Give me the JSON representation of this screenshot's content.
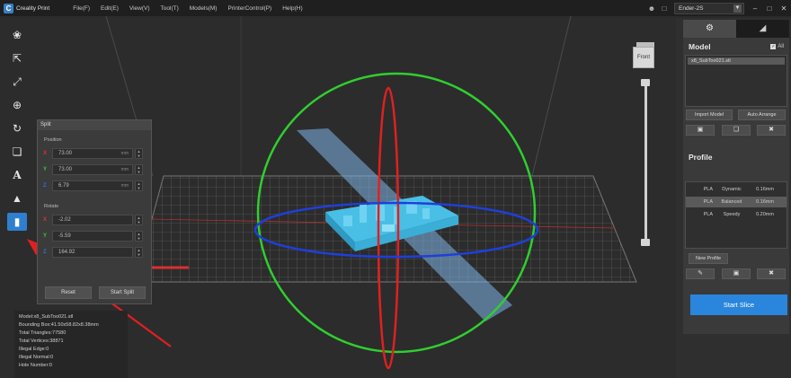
{
  "app": {
    "title": "Creality Print"
  },
  "menu": [
    "File(F)",
    "Edit(E)",
    "View(V)",
    "Tool(T)",
    "Models(M)",
    "PrinterControl(P)",
    "Help(H)"
  ],
  "printer": {
    "selected": "Ender-2S"
  },
  "viewport": {
    "cube_label": "Front"
  },
  "split_panel": {
    "title": "Split",
    "position_label": "Position",
    "position": [
      {
        "axis": "X",
        "value": "73.00",
        "unit": "mm"
      },
      {
        "axis": "Y",
        "value": "73.00",
        "unit": "mm"
      },
      {
        "axis": "Z",
        "value": "6.79",
        "unit": "mm"
      }
    ],
    "rotate_label": "Rotate",
    "rotate": [
      {
        "axis": "X",
        "value": "-2.02"
      },
      {
        "axis": "Y",
        "value": "-5.59"
      },
      {
        "axis": "Z",
        "value": "164.92"
      }
    ],
    "reset_label": "Reset",
    "start_label": "Start Split"
  },
  "info": {
    "lines": [
      "Model:x8_SubToo021.stl",
      "Bounding Box:41.50x58.82x8.38mm",
      "Total Triangles:77580",
      "Total Vertices:38871",
      "Illegal Edge:0",
      "Illegal Normal:0",
      "Hole Number:0"
    ]
  },
  "right_panel": {
    "model_title": "Model",
    "all_label": "All",
    "model_items": [
      "x8_SubToo021.stl"
    ],
    "import_label": "Import Model",
    "arrange_label": "Auto Arrange",
    "profile_title": "Profile",
    "profiles": [
      {
        "material": "PLA",
        "name": "Dynamic",
        "layer": "0.16mm",
        "selected": false
      },
      {
        "material": "PLA",
        "name": "Balanced",
        "layer": "0.16mm",
        "selected": true
      },
      {
        "material": "PLA",
        "name": "Speedy",
        "layer": "0.20mm",
        "selected": false
      }
    ],
    "new_profile_label": "New Profile",
    "start_slice_label": "Start Slice"
  },
  "colors": {
    "accent": "#2a86dc",
    "x_axis": "#e03030",
    "y_axis": "#30d030",
    "z_axis": "#2f6fe0",
    "model": "#4fc3e8"
  },
  "icons": [
    "shapes-icon",
    "pointer-icon",
    "scale-icon",
    "zoom-icon",
    "rotate-icon",
    "copy-icon",
    "text-icon",
    "support-icon",
    "split-icon"
  ]
}
